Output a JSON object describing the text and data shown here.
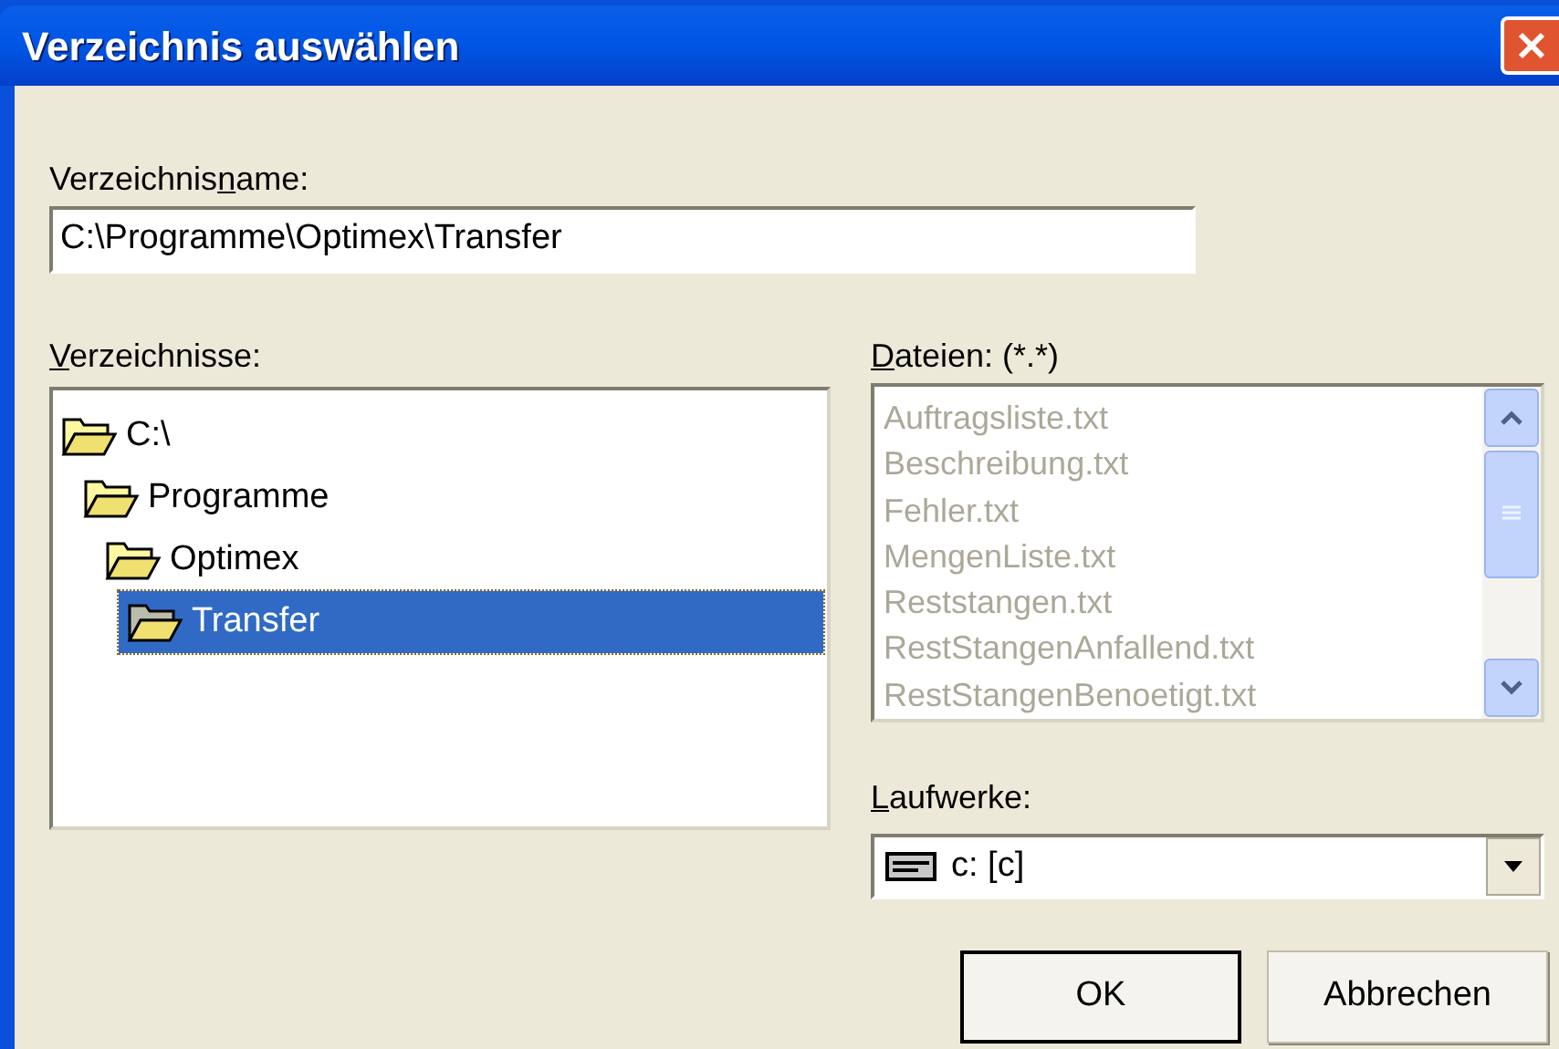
{
  "window": {
    "title": "Verzeichnis auswählen"
  },
  "directory_name": {
    "label": {
      "before": "Verzeichnis",
      "key": "n",
      "after": "ame:"
    },
    "value": "C:\\Programme\\Optimex\\Transfer"
  },
  "directories": {
    "label": {
      "key": "V",
      "after": "erzeichnisse:"
    },
    "items": [
      {
        "name": "C:\\",
        "selected": false,
        "children": [
          {
            "name": "Programme",
            "selected": false,
            "children": [
              {
                "name": "Optimex",
                "selected": false,
                "children": [
                  {
                    "name": "Transfer",
                    "selected": true
                  }
                ]
              }
            ]
          }
        ]
      }
    ]
  },
  "files": {
    "label": {
      "key": "D",
      "after": "ateien: (*.*)"
    },
    "disabled": true,
    "items": [
      "Auftragsliste.txt",
      "Beschreibung.txt",
      "Fehler.txt",
      "MengenListe.txt",
      "Reststangen.txt",
      "RestStangenAnfallend.txt",
      "RestStangenBenoetigt.txt"
    ]
  },
  "drives": {
    "label": {
      "key": "L",
      "after": "aufwerke:"
    },
    "value": "c: [c]"
  },
  "buttons": [
    {
      "label": "OK",
      "default": true
    },
    {
      "label": "Abbrechen",
      "default": false
    }
  ]
}
